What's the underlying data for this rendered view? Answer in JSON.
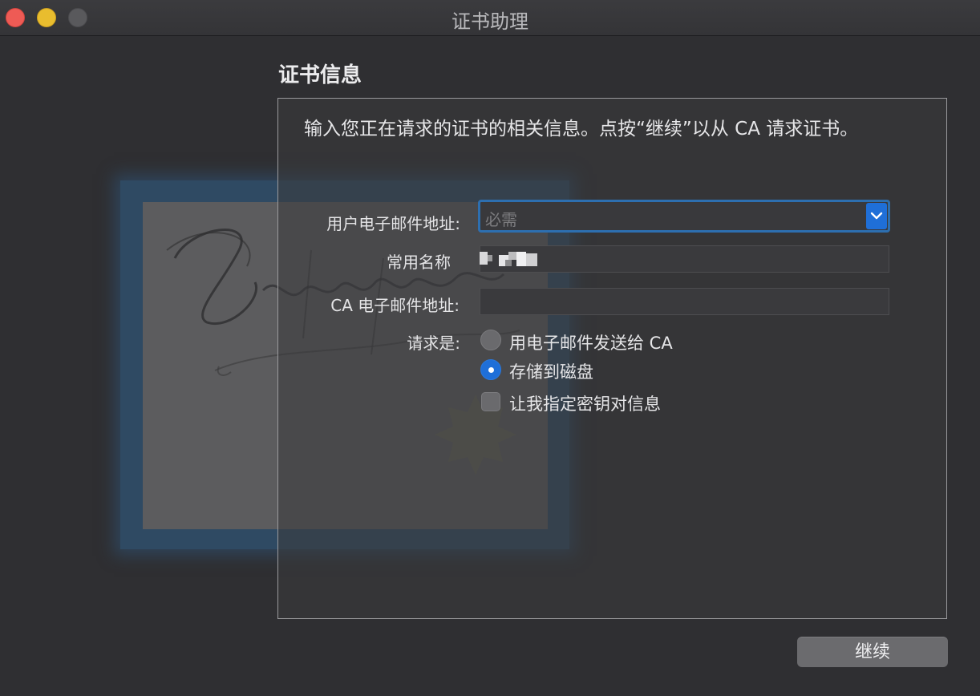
{
  "window": {
    "title": "证书助理"
  },
  "section": {
    "title": "证书信息",
    "description": "输入您正在请求的证书的相关信息。点按“继续”以从 CA 请求证书。"
  },
  "form": {
    "email_label": "用户电子邮件地址:",
    "email_placeholder": "必需",
    "common_name_label": "常用名称",
    "ca_email_label": "CA 电子邮件地址:",
    "request_label": "请求是:",
    "options": [
      {
        "label": "用电子邮件发送给 CA",
        "selected": false
      },
      {
        "label": "存储到磁盘",
        "selected": true
      }
    ],
    "key_pair_label": "让我指定密钥对信息",
    "key_pair_checked": false
  },
  "footer": {
    "continue_label": "继续"
  },
  "colors": {
    "accent": "#1f6fd8",
    "focus_ring": "#2d6fb0",
    "close": "#ee5b55",
    "minimize": "#e9bd2e"
  },
  "icons": {
    "dropdown": "chevron-down-icon",
    "certificate": "certificate-art-icon"
  }
}
